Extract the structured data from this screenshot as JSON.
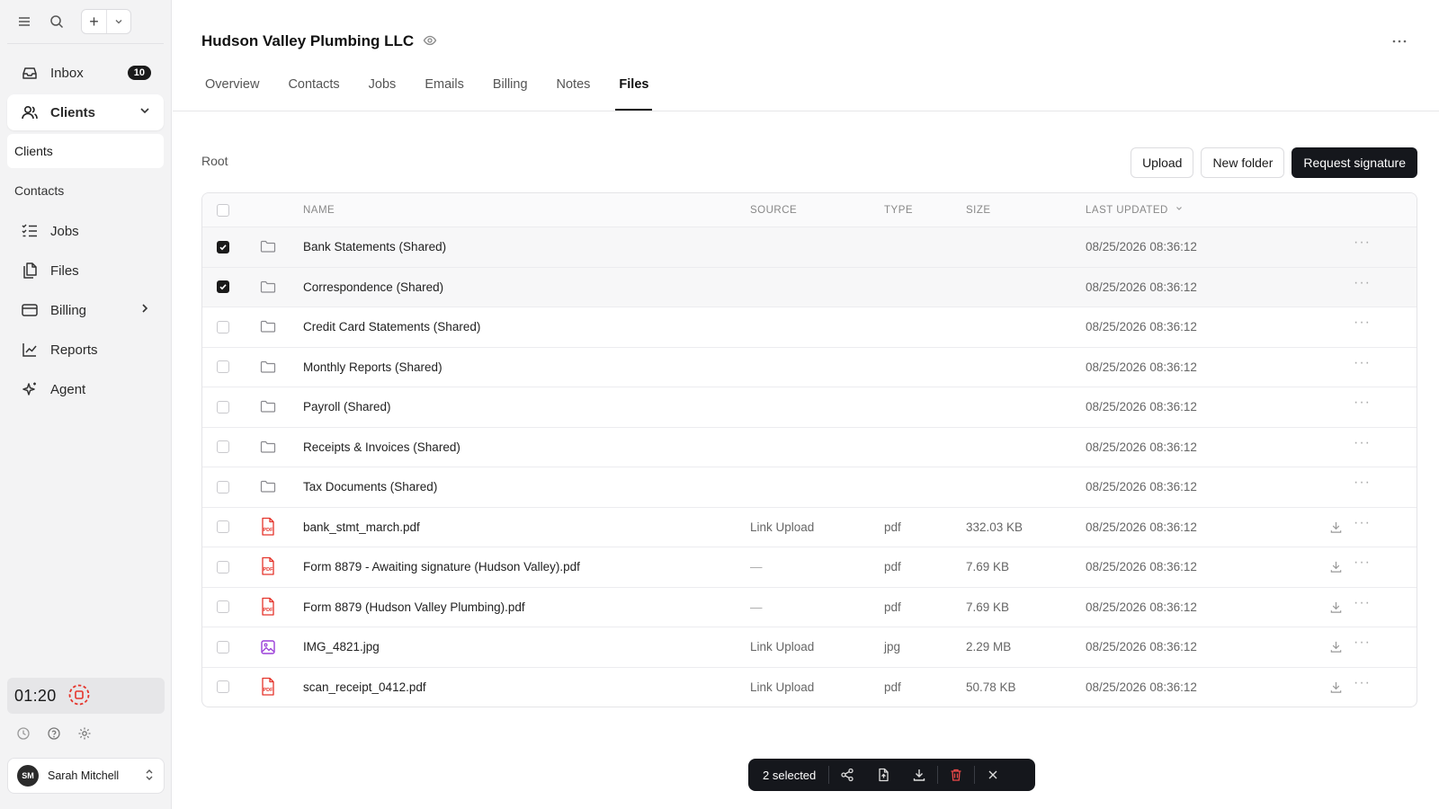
{
  "sidebar": {
    "inbox": {
      "label": "Inbox",
      "badge": "10"
    },
    "clients": {
      "label": "Clients"
    },
    "sub_items": [
      "Clients",
      "Contacts"
    ],
    "jobs": "Jobs",
    "files": "Files",
    "billing": "Billing",
    "reports": "Reports",
    "agent": "Agent",
    "timer": "01:20",
    "user": {
      "initials": "SM",
      "name": "Sarah Mitchell"
    }
  },
  "header": {
    "title": "Hudson Valley Plumbing LLC"
  },
  "tabs": [
    "Overview",
    "Contacts",
    "Jobs",
    "Emails",
    "Billing",
    "Notes",
    "Files"
  ],
  "active_tab": "Files",
  "breadcrumb": "Root",
  "toolbar": {
    "upload": "Upload",
    "new_folder": "New folder",
    "request_signature": "Request signature"
  },
  "table": {
    "columns": {
      "name": "NAME",
      "source": "SOURCE",
      "type": "TYPE",
      "size": "SIZE",
      "updated": "LAST UPDATED"
    },
    "rows": [
      {
        "kind": "folder",
        "name": "Bank Statements (Shared)",
        "source": "",
        "type": "",
        "size": "",
        "updated": "08/25/2026 08:36:12",
        "checked": true
      },
      {
        "kind": "folder",
        "name": "Correspondence (Shared)",
        "source": "",
        "type": "",
        "size": "",
        "updated": "08/25/2026 08:36:12",
        "checked": true
      },
      {
        "kind": "folder",
        "name": "Credit Card Statements (Shared)",
        "source": "",
        "type": "",
        "size": "",
        "updated": "08/25/2026 08:36:12",
        "checked": false
      },
      {
        "kind": "folder",
        "name": "Monthly Reports (Shared)",
        "source": "",
        "type": "",
        "size": "",
        "updated": "08/25/2026 08:36:12",
        "checked": false
      },
      {
        "kind": "folder",
        "name": "Payroll (Shared)",
        "source": "",
        "type": "",
        "size": "",
        "updated": "08/25/2026 08:36:12",
        "checked": false
      },
      {
        "kind": "folder",
        "name": "Receipts & Invoices (Shared)",
        "source": "",
        "type": "",
        "size": "",
        "updated": "08/25/2026 08:36:12",
        "checked": false
      },
      {
        "kind": "folder",
        "name": "Tax Documents (Shared)",
        "source": "",
        "type": "",
        "size": "",
        "updated": "08/25/2026 08:36:12",
        "checked": false
      },
      {
        "kind": "pdf",
        "name": "bank_stmt_march.pdf",
        "source": "Link Upload",
        "type": "pdf",
        "size": "332.03 KB",
        "updated": "08/25/2026 08:36:12",
        "checked": false
      },
      {
        "kind": "pdf",
        "name": "Form 8879 - Awaiting signature (Hudson Valley).pdf",
        "source": "—",
        "type": "pdf",
        "size": "7.69 KB",
        "updated": "08/25/2026 08:36:12",
        "checked": false
      },
      {
        "kind": "pdf",
        "name": "Form 8879 (Hudson Valley Plumbing).pdf",
        "source": "—",
        "type": "pdf",
        "size": "7.69 KB",
        "updated": "08/25/2026 08:36:12",
        "checked": false
      },
      {
        "kind": "image",
        "name": "IMG_4821.jpg",
        "source": "Link Upload",
        "type": "jpg",
        "size": "2.29 MB",
        "updated": "08/25/2026 08:36:12",
        "checked": false
      },
      {
        "kind": "pdf",
        "name": "scan_receipt_0412.pdf",
        "source": "Link Upload",
        "type": "pdf",
        "size": "50.78 KB",
        "updated": "08/25/2026 08:36:12",
        "checked": false
      }
    ]
  },
  "selection_bar": {
    "label": "2 selected"
  },
  "colors": {
    "accent": "#15171c",
    "danger": "#f04a4a",
    "pdf": "#e5342b",
    "image": "#9b3fd8"
  }
}
